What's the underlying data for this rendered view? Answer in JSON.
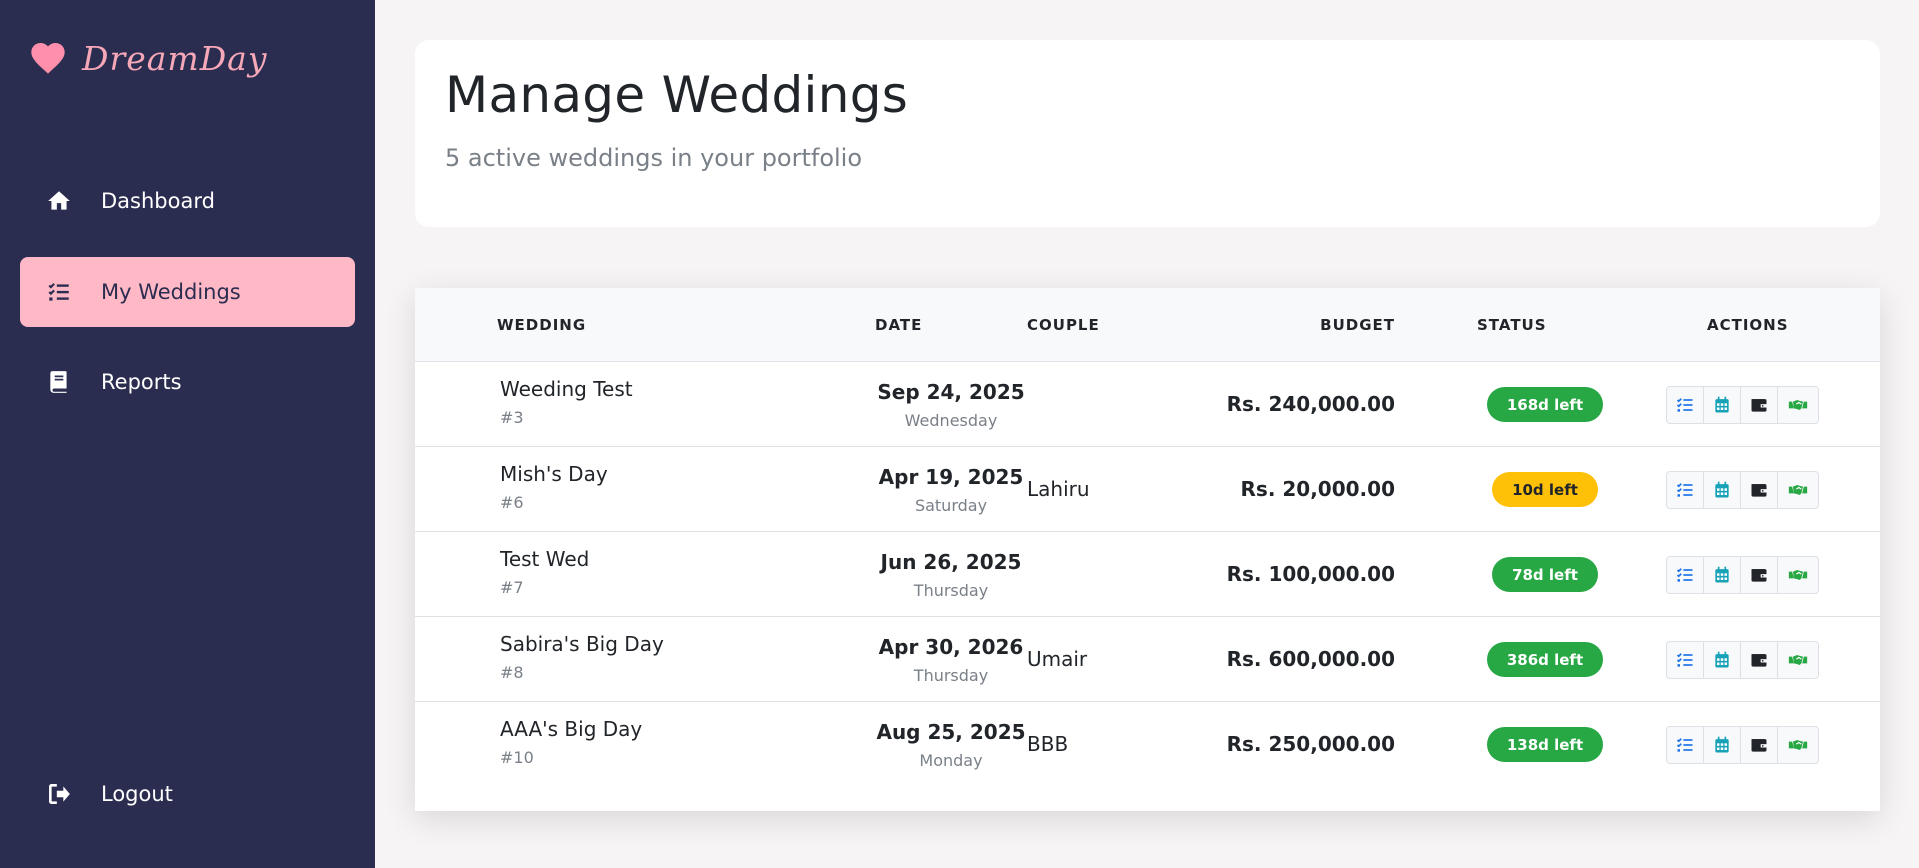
{
  "brand": {
    "name": "DreamDay",
    "accent": "#ffb8c6"
  },
  "nav": {
    "items": [
      {
        "label": "Dashboard",
        "icon": "home-icon"
      },
      {
        "label": "My Weddings",
        "icon": "checklist-icon",
        "active": true
      },
      {
        "label": "Reports",
        "icon": "book-icon"
      }
    ],
    "logout": {
      "label": "Logout",
      "icon": "logout-icon"
    }
  },
  "header": {
    "title": "Manage Weddings",
    "subtitle": "5 active weddings in your portfolio"
  },
  "table": {
    "columns": {
      "wedding": "WEDDING",
      "date": "DATE",
      "couple": "COUPLE",
      "budget": "BUDGET",
      "status": "STATUS",
      "actions": "ACTIONS"
    },
    "rows": [
      {
        "name": "Weeding Test",
        "id": "#3",
        "date": "Sep 24, 2025",
        "day": "Wednesday",
        "couple": "",
        "budget": "Rs. 240,000.00",
        "status": "168d left",
        "status_color": "green"
      },
      {
        "name": "Mish's Day",
        "id": "#6",
        "date": "Apr 19, 2025",
        "day": "Saturday",
        "couple": "Lahiru",
        "budget": "Rs. 20,000.00",
        "status": "10d left",
        "status_color": "yellow"
      },
      {
        "name": "Test Wed",
        "id": "#7",
        "date": "Jun 26, 2025",
        "day": "Thursday",
        "couple": "",
        "budget": "Rs. 100,000.00",
        "status": "78d left",
        "status_color": "green"
      },
      {
        "name": "Sabira's Big Day",
        "id": "#8",
        "date": "Apr 30, 2026",
        "day": "Thursday",
        "couple": "Umair",
        "budget": "Rs. 600,000.00",
        "status": "386d left",
        "status_color": "green"
      },
      {
        "name": "AAA's Big Day",
        "id": "#10",
        "date": "Aug 25, 2025",
        "day": "Monday",
        "couple": "BBB",
        "budget": "Rs. 250,000.00",
        "status": "138d left",
        "status_color": "green"
      }
    ],
    "action_icons": [
      "checklist-icon",
      "calendar-icon",
      "wallet-icon",
      "handshake-icon"
    ]
  },
  "colors": {
    "sidebar": "#2b2d50",
    "status_green": "#28a745",
    "status_yellow": "#ffc107",
    "action_blue": "#1a73e8",
    "action_teal": "#17a2b8",
    "action_dark": "#212529",
    "action_green": "#28a745"
  }
}
